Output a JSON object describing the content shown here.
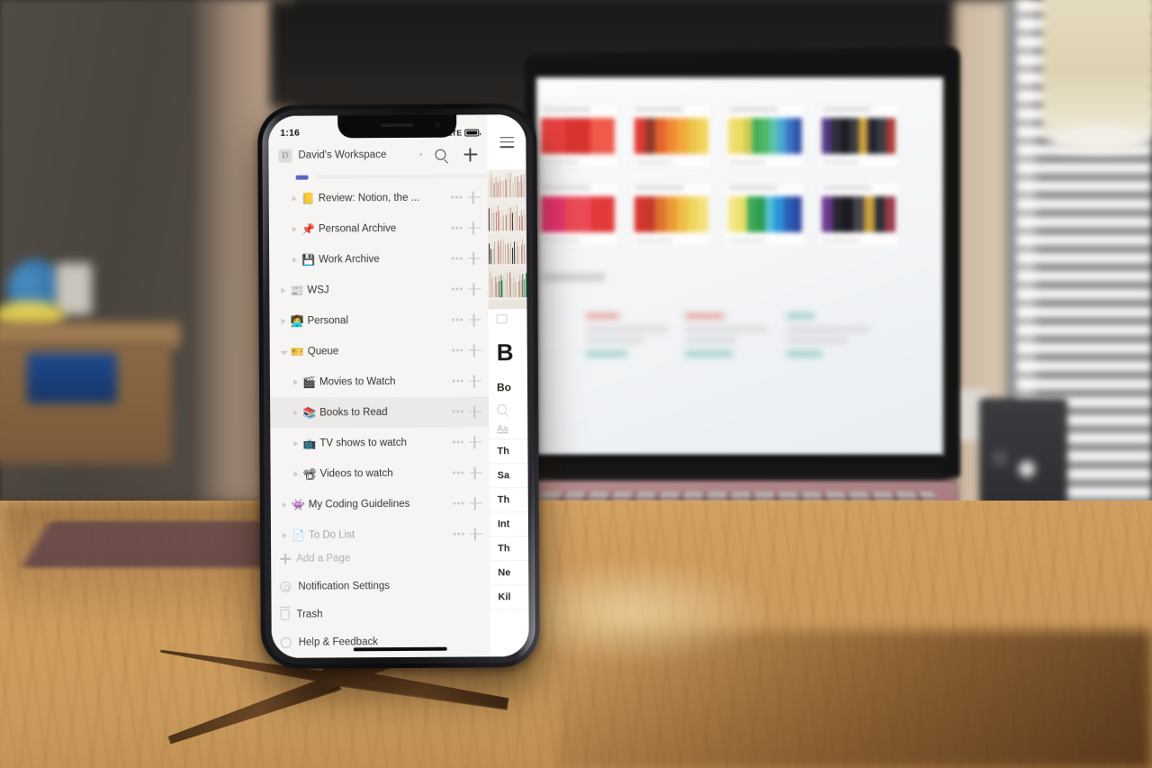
{
  "scene": {
    "description": "iPhone X standing on a live-edge wooden table in front of a rose-gold laptop showing Notion"
  },
  "phone": {
    "status_bar": {
      "time": "1:16",
      "carrier_network": "LTE",
      "signal_icon": "cellular-signal-icon",
      "battery_icon": "battery-icon"
    },
    "home_indicator": "home-indicator"
  },
  "sidebar": {
    "workspace": {
      "avatar_letter": "D",
      "name": "David's Workspace",
      "caret_icon": "chevron-down-icon",
      "search_icon": "search-icon",
      "add_icon": "plus-icon"
    },
    "nav_items": [
      {
        "label": "Review: Notion, the ...",
        "emoji": "📒",
        "emoji_name": "notebook-icon",
        "level": 1,
        "expanded": false,
        "selected": false,
        "muted": false
      },
      {
        "label": "Personal Archive",
        "emoji": "📌",
        "emoji_name": "pushpin-icon",
        "level": 1,
        "expanded": false,
        "selected": false,
        "muted": false
      },
      {
        "label": "Work Archive",
        "emoji": "💾",
        "emoji_name": "floppy-disk-icon",
        "level": 1,
        "expanded": false,
        "selected": false,
        "muted": false
      },
      {
        "label": "WSJ",
        "emoji": "📰",
        "emoji_name": "newspaper-icon",
        "level": 0,
        "expanded": false,
        "selected": false,
        "muted": false
      },
      {
        "label": "Personal",
        "emoji": "👩‍💻",
        "emoji_name": "person-computer-icon",
        "level": 0,
        "expanded": false,
        "selected": false,
        "muted": false
      },
      {
        "label": "Queue",
        "emoji": "🎫",
        "emoji_name": "ticket-icon",
        "level": 0,
        "expanded": true,
        "selected": false,
        "muted": false
      },
      {
        "label": "Movies to Watch",
        "emoji": "🎬",
        "emoji_name": "clapper-board-icon",
        "level": 1,
        "expanded": false,
        "selected": false,
        "muted": false
      },
      {
        "label": "Books to Read",
        "emoji": "📚",
        "emoji_name": "books-icon",
        "level": 1,
        "expanded": false,
        "selected": true,
        "muted": false
      },
      {
        "label": "TV shows to watch",
        "emoji": "📺",
        "emoji_name": "television-icon",
        "level": 1,
        "expanded": false,
        "selected": false,
        "muted": false
      },
      {
        "label": "Videos to watch",
        "emoji": "📽",
        "emoji_name": "film-projector-icon",
        "level": 1,
        "expanded": false,
        "selected": false,
        "muted": false
      },
      {
        "label": "My Coding Guidelines",
        "emoji": "👾",
        "emoji_name": "alien-monster-icon",
        "level": 0,
        "expanded": false,
        "selected": false,
        "muted": false
      },
      {
        "label": "To Do List",
        "emoji": "📄",
        "emoji_name": "page-icon",
        "level": 0,
        "expanded": false,
        "selected": false,
        "muted": true
      }
    ],
    "row_actions": {
      "more_icon": "•••",
      "more_name": "more-options-icon",
      "add_icon": "add-page-icon"
    },
    "add_page": {
      "label": "Add a Page",
      "icon": "plus-icon"
    },
    "footer_items": [
      {
        "label": "Notification Settings",
        "icon": "gear-icon"
      },
      {
        "label": "Trash",
        "icon": "trash-icon"
      },
      {
        "label": "Help & Feedback",
        "icon": "help-circle-icon"
      }
    ]
  },
  "content_panel": {
    "menu_icon": "hamburger-menu-icon",
    "cover_alt": "bookshelf-cover-image",
    "comment_icon": "comment-icon",
    "title": "B",
    "subtitle": "Bo",
    "search_icon": "search-icon",
    "filter_label": "Aa",
    "rows": [
      "Th",
      "Sa",
      "Th",
      "Int",
      "Th",
      "Ne",
      "Kil"
    ]
  },
  "colors": {
    "sidebar_bg": "#f6f5f4",
    "selected_row": "#eceae8",
    "text_primary": "#36352f",
    "text_muted": "#a8a5a1",
    "icon_gray": "#cbc8c4",
    "phone_frame": "#111113",
    "table_wood": "#c99a5b",
    "laptop_rose": "#a87c7f"
  }
}
